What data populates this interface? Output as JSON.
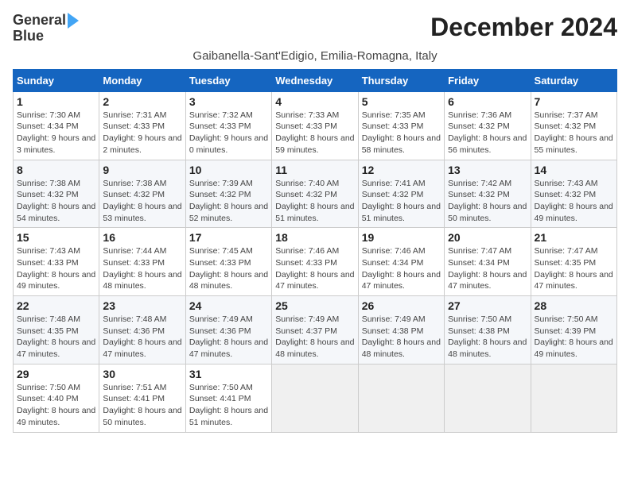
{
  "logo": {
    "line1": "General",
    "line2": "Blue"
  },
  "title": "December 2024",
  "subtitle": "Gaibanella-Sant'Edigio, Emilia-Romagna, Italy",
  "headers": [
    "Sunday",
    "Monday",
    "Tuesday",
    "Wednesday",
    "Thursday",
    "Friday",
    "Saturday"
  ],
  "weeks": [
    [
      {
        "day": "1",
        "sunrise": "7:30 AM",
        "sunset": "4:34 PM",
        "daylight": "9 hours and 3 minutes."
      },
      {
        "day": "2",
        "sunrise": "7:31 AM",
        "sunset": "4:33 PM",
        "daylight": "9 hours and 2 minutes."
      },
      {
        "day": "3",
        "sunrise": "7:32 AM",
        "sunset": "4:33 PM",
        "daylight": "9 hours and 0 minutes."
      },
      {
        "day": "4",
        "sunrise": "7:33 AM",
        "sunset": "4:33 PM",
        "daylight": "8 hours and 59 minutes."
      },
      {
        "day": "5",
        "sunrise": "7:35 AM",
        "sunset": "4:33 PM",
        "daylight": "8 hours and 58 minutes."
      },
      {
        "day": "6",
        "sunrise": "7:36 AM",
        "sunset": "4:32 PM",
        "daylight": "8 hours and 56 minutes."
      },
      {
        "day": "7",
        "sunrise": "7:37 AM",
        "sunset": "4:32 PM",
        "daylight": "8 hours and 55 minutes."
      }
    ],
    [
      {
        "day": "8",
        "sunrise": "7:38 AM",
        "sunset": "4:32 PM",
        "daylight": "8 hours and 54 minutes."
      },
      {
        "day": "9",
        "sunrise": "7:38 AM",
        "sunset": "4:32 PM",
        "daylight": "8 hours and 53 minutes."
      },
      {
        "day": "10",
        "sunrise": "7:39 AM",
        "sunset": "4:32 PM",
        "daylight": "8 hours and 52 minutes."
      },
      {
        "day": "11",
        "sunrise": "7:40 AM",
        "sunset": "4:32 PM",
        "daylight": "8 hours and 51 minutes."
      },
      {
        "day": "12",
        "sunrise": "7:41 AM",
        "sunset": "4:32 PM",
        "daylight": "8 hours and 51 minutes."
      },
      {
        "day": "13",
        "sunrise": "7:42 AM",
        "sunset": "4:32 PM",
        "daylight": "8 hours and 50 minutes."
      },
      {
        "day": "14",
        "sunrise": "7:43 AM",
        "sunset": "4:32 PM",
        "daylight": "8 hours and 49 minutes."
      }
    ],
    [
      {
        "day": "15",
        "sunrise": "7:43 AM",
        "sunset": "4:33 PM",
        "daylight": "8 hours and 49 minutes."
      },
      {
        "day": "16",
        "sunrise": "7:44 AM",
        "sunset": "4:33 PM",
        "daylight": "8 hours and 48 minutes."
      },
      {
        "day": "17",
        "sunrise": "7:45 AM",
        "sunset": "4:33 PM",
        "daylight": "8 hours and 48 minutes."
      },
      {
        "day": "18",
        "sunrise": "7:46 AM",
        "sunset": "4:33 PM",
        "daylight": "8 hours and 47 minutes."
      },
      {
        "day": "19",
        "sunrise": "7:46 AM",
        "sunset": "4:34 PM",
        "daylight": "8 hours and 47 minutes."
      },
      {
        "day": "20",
        "sunrise": "7:47 AM",
        "sunset": "4:34 PM",
        "daylight": "8 hours and 47 minutes."
      },
      {
        "day": "21",
        "sunrise": "7:47 AM",
        "sunset": "4:35 PM",
        "daylight": "8 hours and 47 minutes."
      }
    ],
    [
      {
        "day": "22",
        "sunrise": "7:48 AM",
        "sunset": "4:35 PM",
        "daylight": "8 hours and 47 minutes."
      },
      {
        "day": "23",
        "sunrise": "7:48 AM",
        "sunset": "4:36 PM",
        "daylight": "8 hours and 47 minutes."
      },
      {
        "day": "24",
        "sunrise": "7:49 AM",
        "sunset": "4:36 PM",
        "daylight": "8 hours and 47 minutes."
      },
      {
        "day": "25",
        "sunrise": "7:49 AM",
        "sunset": "4:37 PM",
        "daylight": "8 hours and 48 minutes."
      },
      {
        "day": "26",
        "sunrise": "7:49 AM",
        "sunset": "4:38 PM",
        "daylight": "8 hours and 48 minutes."
      },
      {
        "day": "27",
        "sunrise": "7:50 AM",
        "sunset": "4:38 PM",
        "daylight": "8 hours and 48 minutes."
      },
      {
        "day": "28",
        "sunrise": "7:50 AM",
        "sunset": "4:39 PM",
        "daylight": "8 hours and 49 minutes."
      }
    ],
    [
      {
        "day": "29",
        "sunrise": "7:50 AM",
        "sunset": "4:40 PM",
        "daylight": "8 hours and 49 minutes."
      },
      {
        "day": "30",
        "sunrise": "7:51 AM",
        "sunset": "4:41 PM",
        "daylight": "8 hours and 50 minutes."
      },
      {
        "day": "31",
        "sunrise": "7:50 AM",
        "sunset": "4:41 PM",
        "daylight": "8 hours and 51 minutes."
      },
      null,
      null,
      null,
      null
    ]
  ]
}
